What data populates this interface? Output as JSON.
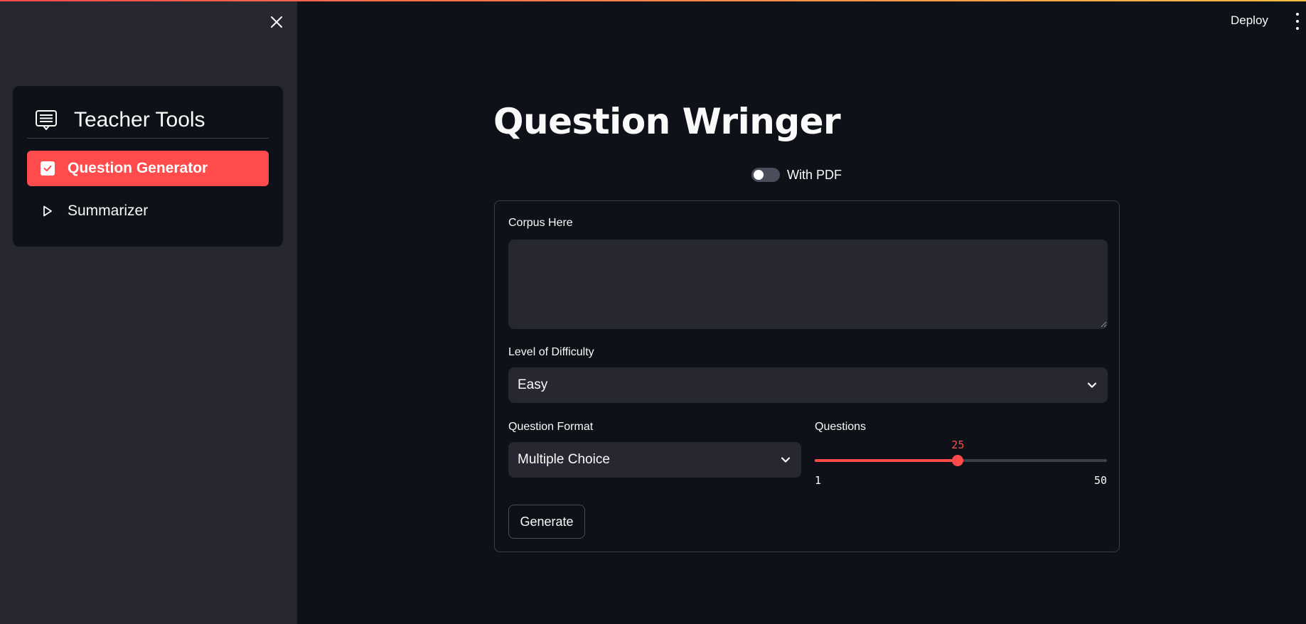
{
  "sidebar": {
    "title": "Teacher Tools",
    "items": [
      {
        "label": "Question Generator",
        "active": true,
        "icon": "checkbox-icon"
      },
      {
        "label": "Summarizer",
        "active": false,
        "icon": "play-outline-icon"
      }
    ]
  },
  "header": {
    "deploy_label": "Deploy"
  },
  "main": {
    "title": "Question Wringer",
    "toggle": {
      "label": "With PDF",
      "on": false
    },
    "form": {
      "corpus": {
        "label": "Corpus Here",
        "value": ""
      },
      "difficulty": {
        "label": "Level of Difficulty",
        "value": "Easy"
      },
      "format": {
        "label": "Question Format",
        "value": "Multiple Choice"
      },
      "questions": {
        "label": "Questions",
        "value": "25",
        "min": "1",
        "max": "50"
      },
      "generate_label": "Generate"
    }
  },
  "colors": {
    "accent": "#ff4b4b",
    "background": "#0e1117",
    "sidebar": "#262730",
    "input": "#262730"
  }
}
